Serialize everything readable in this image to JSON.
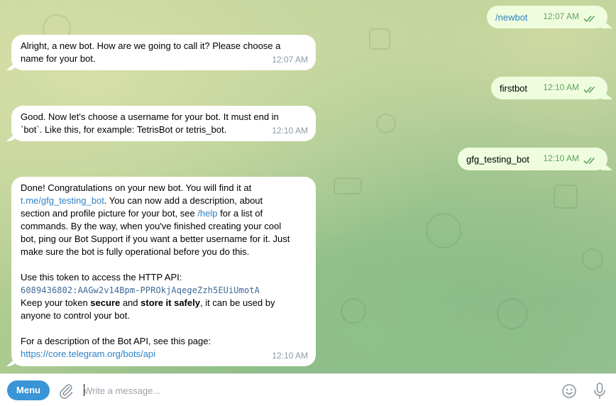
{
  "colors": {
    "incoming_bubble": "#ffffff",
    "outgoing_bubble": "#effdde",
    "link": "#2e82c7",
    "menu_button": "#3a95d6",
    "outgoing_time": "#5ea35f"
  },
  "messages": {
    "m1_out": {
      "text": "/newbot",
      "time": "12:07 AM"
    },
    "m2_in": {
      "line1": "Alright, a new bot. How are we going to call it? Please choose a",
      "line2": "name for your bot.",
      "time": "12:07 AM"
    },
    "m3_out": {
      "text": "firstbot",
      "time": "12:10 AM"
    },
    "m4_in": {
      "line1": "Good. Now let's choose a username for your bot. It must end in",
      "line2": "`bot`. Like this, for example: TetrisBot or tetris_bot.",
      "time": "12:10 AM"
    },
    "m5_out": {
      "text": "gfg_testing_bot",
      "time": "12:10 AM"
    },
    "m6_in": {
      "p1_a": "Done! Congratulations on your new bot. You will find it at",
      "p1_link": "t.me/gfg_testing_bot",
      "p1_b": ". You can now add a description, about",
      "p1_c": "section and profile picture for your bot, see ",
      "p1_help": "/help",
      "p1_d": " for a list of",
      "p1_e": "commands. By the way, when you've finished creating your cool",
      "p1_f": "bot, ping our Bot Support if you want a better username for it. Just",
      "p1_g": "make sure the bot is fully operational before you do this.",
      "p2_a": "Use this token to access the HTTP API:",
      "p2_token": "6089436802:AAGw2v14Bpm-PPROkjAqegeZzh5EUiUmotA",
      "p2_b": "Keep your token ",
      "p2_secure": "secure",
      "p2_c": " and ",
      "p2_store": "store it safely",
      "p2_d": ", it can be used by",
      "p2_e": "anyone to control your bot.",
      "p3_a": "For a description of the Bot API, see this page:",
      "p3_link": "https://core.telegram.org/bots/api",
      "time": "12:10 AM"
    }
  },
  "composer": {
    "menu_label": "Menu",
    "placeholder": "Write a message...",
    "attach_icon": "paperclip-icon",
    "emoji_icon": "emoji-icon",
    "mic_icon": "microphone-icon"
  }
}
